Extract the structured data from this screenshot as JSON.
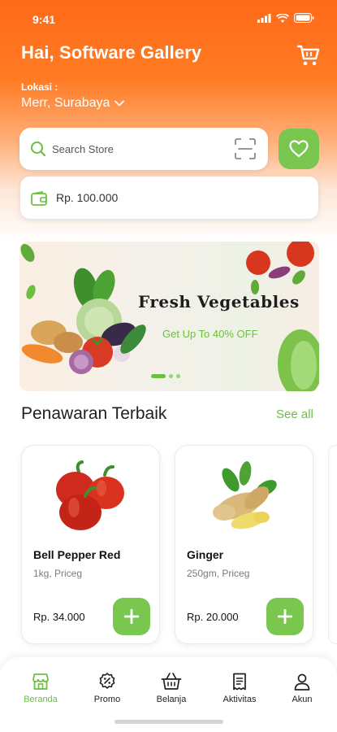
{
  "status_bar": {
    "time": "9:41"
  },
  "header": {
    "greeting": "Hai, Software Gallery",
    "location_label": "Lokasi :",
    "location_value": "Merr, Surabaya"
  },
  "search": {
    "placeholder": "Search Store"
  },
  "wallet": {
    "balance": "Rp. 100.000"
  },
  "banner": {
    "title": "Fresh Vegetables",
    "subtitle": "Get Up To 40% OFF",
    "slide_count": 3,
    "active_slide": 1
  },
  "offers": {
    "title": "Penawaran Terbaik",
    "see_all": "See all",
    "products": [
      {
        "name": "Bell Pepper Red",
        "desc": "1kg, Priceg",
        "price": "Rp. 34.000",
        "image_icon": "bell-pepper-image"
      },
      {
        "name": "Ginger",
        "desc": "250gm, Priceg",
        "price": "Rp. 20.000",
        "image_icon": "ginger-image"
      }
    ]
  },
  "bottom_nav": {
    "items": [
      {
        "label": "Beranda",
        "icon": "store-icon",
        "active": true
      },
      {
        "label": "Promo",
        "icon": "promo-icon",
        "active": false
      },
      {
        "label": "Belanja",
        "icon": "basket-icon",
        "active": false
      },
      {
        "label": "Aktivitas",
        "icon": "receipt-icon",
        "active": false
      },
      {
        "label": "Akun",
        "icon": "user-icon",
        "active": false
      }
    ]
  },
  "colors": {
    "accent_orange": "#ff6a1a",
    "accent_green": "#7ac74f",
    "price_green": "#6cbf3f"
  }
}
